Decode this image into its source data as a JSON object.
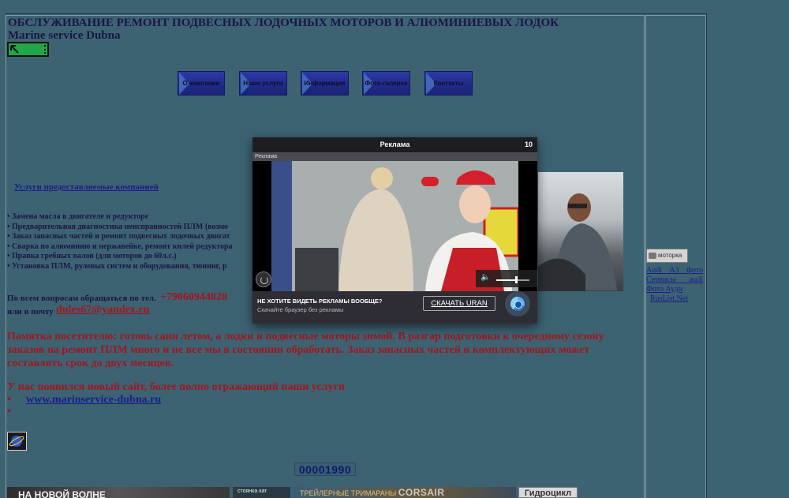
{
  "header": {
    "title": "ОБСЛУЖИВАНИЕ РЕМОНТ ПОДВЕСНЫХ ЛОДОЧНЫХ МОТОРОВ И АЛЮМИНИЕВЫХ ЛОДОК",
    "subtitle": "Marine service Dubna"
  },
  "nav": {
    "items": [
      {
        "label": "О компании"
      },
      {
        "label": "Наши услуги"
      },
      {
        "label": "Информация"
      },
      {
        "label": "Фото-галерея"
      },
      {
        "label": "Контакты"
      }
    ]
  },
  "services": {
    "link": "Услуги предоставляемые компанией",
    "items": [
      "Замена масла в двигателе и редукторе",
      "Предварительная диагностика неисправностей ПЛМ (возмо",
      "Заказ запасных частей и ремонт подвесных лодочных двигат",
      "Сварка по алюминию и нержавейке, ремонт килей редуктора",
      "Правка гребных валов (для моторов до 60л.с.)",
      "Установка ПЛМ, рулевых систем и оборудования, тюнинг, р"
    ]
  },
  "contacts": {
    "phone_prefix": "По всем вопросам обращаться по тел.",
    "phone": "+79060944828",
    "email_prefix": "или в почту",
    "email": "dules67@yandex.ru"
  },
  "notice": "Памятка посетителю: готовь сани летом, а лодки и подвесные моторы зимой. В разгар подготовки к очередному сезону заказов на ремонт ПЛМ много и не все мы в состоянии обработать. Заказ запасных частей и комплектующих может составлять срок до двух месяцев.",
  "new_site": {
    "text": "У нас появился новый сайт, более полно отражающий наши услуги",
    "bullet": "•",
    "url": "www.marinservice-dubna.ru"
  },
  "counter": "00001990",
  "banners": {
    "b1": "НА НОВОЙ ВОЛНЕ",
    "b2": "стоянка кат",
    "b3_left": "ТРЕЙЛЕРНЫЕ ТРИМАРАНЫ",
    "b3_right": "CORSAIR",
    "b4": "Гидроцикл"
  },
  "sidebar": {
    "motorka": "моторка",
    "links": [
      "Audi A3 фото",
      "Сервисы audi",
      "Фото Ауди"
    ],
    "rus_link": "RusList.Net"
  },
  "ad": {
    "header": "Реклама",
    "timer": "10",
    "sublabel": "Реклама",
    "no_ads": "НЕ ХОТИТЕ ВИДЕТЬ РЕКЛАМЫ ВООБЩЕ?",
    "tagline": "Скачайте браузер без рекламы",
    "download": "СКАЧАТЬ URAN",
    "volume_level": 0.6
  },
  "colors": {
    "page_bg": "#3d6373",
    "accent_red": "#a0161c",
    "link_blue": "#1a1c8a",
    "heading_navy": "#1a1546",
    "nav_button": "#2e3aa6"
  }
}
